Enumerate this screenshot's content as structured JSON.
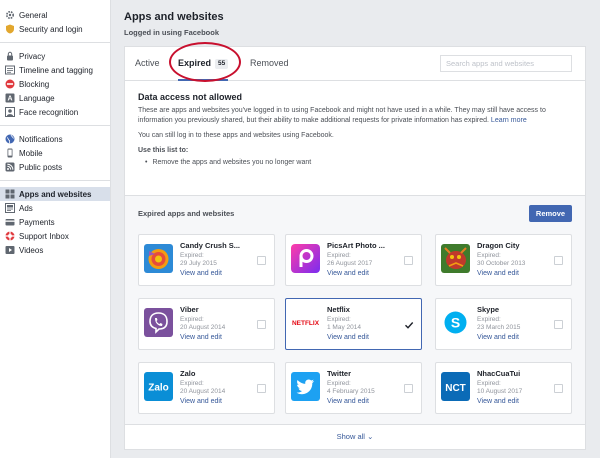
{
  "sidebar": {
    "groups": [
      [
        {
          "label": "General",
          "icon": "gear-icon"
        },
        {
          "label": "Security and login",
          "icon": "shield-icon"
        }
      ],
      [
        {
          "label": "Privacy",
          "icon": "lock-icon"
        },
        {
          "label": "Timeline and tagging",
          "icon": "timeline-icon"
        },
        {
          "label": "Blocking",
          "icon": "block-icon"
        },
        {
          "label": "Language",
          "icon": "language-icon"
        },
        {
          "label": "Face recognition",
          "icon": "face-icon"
        }
      ],
      [
        {
          "label": "Notifications",
          "icon": "globe-icon"
        },
        {
          "label": "Mobile",
          "icon": "mobile-icon"
        },
        {
          "label": "Public posts",
          "icon": "rss-icon"
        }
      ],
      [
        {
          "label": "Apps and websites",
          "icon": "apps-icon",
          "active": true
        },
        {
          "label": "Ads",
          "icon": "ads-icon"
        },
        {
          "label": "Payments",
          "icon": "card-icon"
        },
        {
          "label": "Support Inbox",
          "icon": "lifebuoy-icon"
        },
        {
          "label": "Videos",
          "icon": "video-icon"
        }
      ]
    ]
  },
  "header": {
    "title": "Apps and websites",
    "subtitle": "Logged in using Facebook"
  },
  "tabs": {
    "active_label": "Active",
    "expired_label": "Expired",
    "expired_count": "55",
    "removed_label": "Removed"
  },
  "search": {
    "placeholder": "Search apps and websites",
    "value": ""
  },
  "notice": {
    "title": "Data access not allowed",
    "body": "These are apps and websites you've logged in to using Facebook and might not have used in a while. They may still have access to information you previously shared, but their ability to make additional requests for private information has expired.",
    "learn_more": "Learn more",
    "login_note": "You can still log in to these apps and websites using Facebook.",
    "use_title": "Use this list to:",
    "use_item": "Remove the apps and websites you no longer want"
  },
  "apps_section": {
    "title": "Expired apps and websites",
    "remove_label": "Remove",
    "expired_label": "Expired:",
    "view_edit_label": "View and edit",
    "show_all_label": "Show all"
  },
  "apps": [
    {
      "name": "Candy Crush S...",
      "date": "29 July 2015",
      "icon": "candy-crush-icon",
      "selected": false
    },
    {
      "name": "PicsArt Photo ...",
      "date": "26 August 2017",
      "icon": "picsart-icon",
      "selected": false
    },
    {
      "name": "Dragon City",
      "date": "30 October 2013",
      "icon": "dragon-city-icon",
      "selected": false
    },
    {
      "name": "Viber",
      "date": "20 August 2014",
      "icon": "viber-icon",
      "selected": false
    },
    {
      "name": "Netflix",
      "date": "1 May 2014",
      "icon": "netflix-icon",
      "icon_text": "NETFLIX",
      "selected": true
    },
    {
      "name": "Skype",
      "date": "23 March 2015",
      "icon": "skype-icon",
      "selected": false
    },
    {
      "name": "Zalo",
      "date": "20 August 2014",
      "icon": "zalo-icon",
      "icon_text": "Zalo",
      "selected": false
    },
    {
      "name": "Twitter",
      "date": "4 February 2015",
      "icon": "twitter-icon",
      "selected": false
    },
    {
      "name": "NhacCuaTui",
      "date": "10 August 2017",
      "icon": "nhaccuatui-icon",
      "icon_text": "NCT",
      "selected": false
    }
  ],
  "colors": {
    "facebook_blue": "#4267b2",
    "link": "#365899",
    "annotation_red": "#c8102e"
  }
}
